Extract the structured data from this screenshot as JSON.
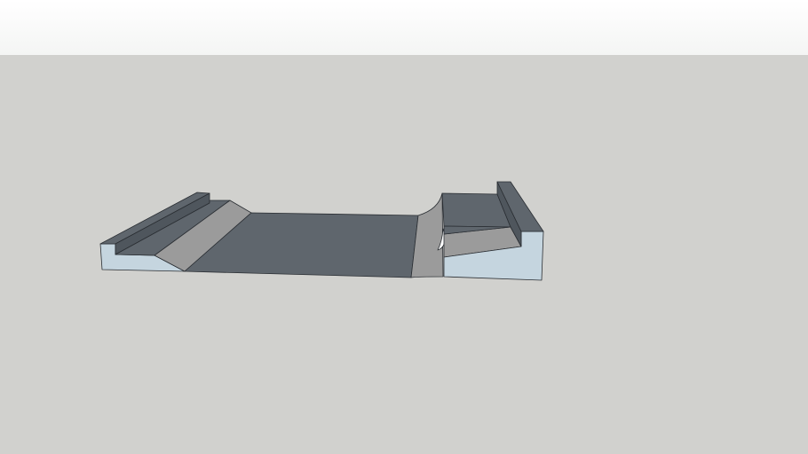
{
  "viewport": {
    "sky_color": "#f4f5f4",
    "ground_color": "#d1d1ce",
    "model": {
      "colors": {
        "dark_face": "#5f666d",
        "ledge_face": "#4f565d",
        "ramp_face": "#9b9b9b",
        "side_face": "#c5d5df",
        "highlight": "#ffffff"
      }
    }
  }
}
